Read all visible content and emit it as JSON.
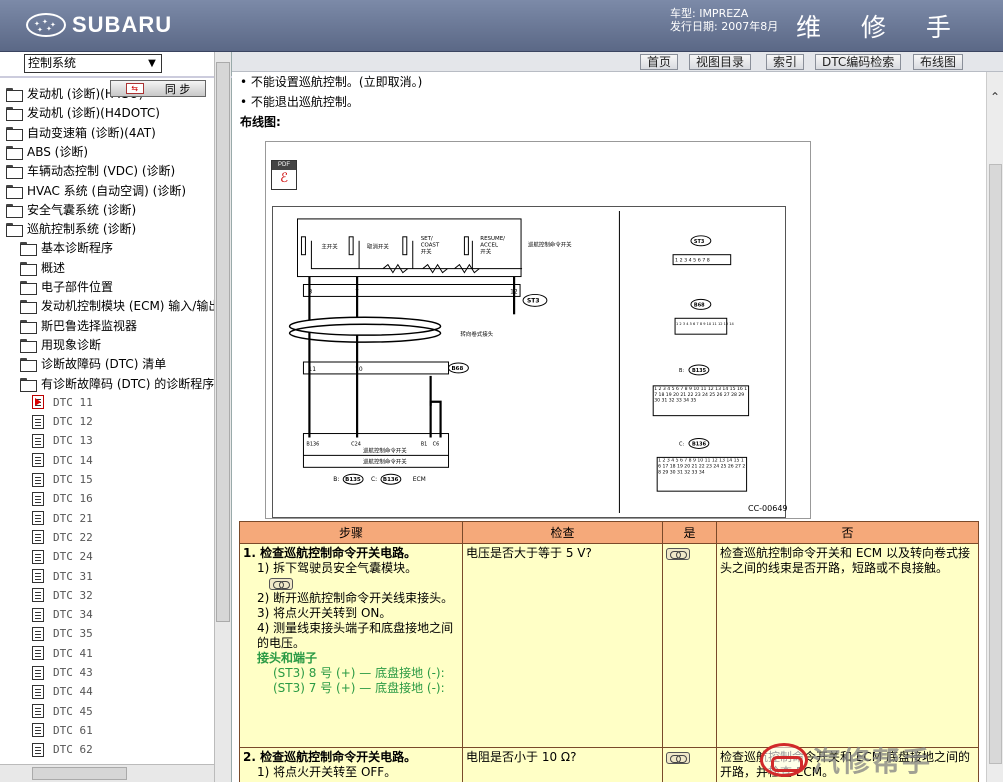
{
  "header": {
    "brand": "SUBARU",
    "model_line": "车型: IMPREZA",
    "issue_date_line": "发行日期: 2007年8月",
    "manual_title": "维 修 手 册"
  },
  "left_panel": {
    "system_select": "控制系统",
    "sync_label": "同 步",
    "sync_icon_text": "⇆",
    "tree": [
      {
        "label": "发动机 (诊断)(H4SO)",
        "type": "folder",
        "level": 0
      },
      {
        "label": "发动机 (诊断)(H4DOTC)",
        "type": "folder",
        "level": 0
      },
      {
        "label": "自动变速箱 (诊断)(4AT)",
        "type": "folder",
        "level": 0
      },
      {
        "label": "ABS (诊断)",
        "type": "folder",
        "level": 0
      },
      {
        "label": "车辆动态控制 (VDC) (诊断)",
        "type": "folder",
        "level": 0
      },
      {
        "label": "HVAC 系统 (自动空调) (诊断)",
        "type": "folder",
        "level": 0
      },
      {
        "label": "安全气囊系统 (诊断)",
        "type": "folder",
        "level": 0
      },
      {
        "label": "巡航控制系统 (诊断)",
        "type": "folder",
        "level": 0
      },
      {
        "label": "基本诊断程序",
        "type": "folder",
        "level": 1
      },
      {
        "label": "概述",
        "type": "folder",
        "level": 1
      },
      {
        "label": "电子部件位置",
        "type": "folder",
        "level": 1
      },
      {
        "label": "发动机控制模块 (ECM) 输入/输出",
        "type": "folder",
        "level": 1
      },
      {
        "label": "斯巴鲁选择监视器",
        "type": "folder",
        "level": 1
      },
      {
        "label": "用现象诊断",
        "type": "folder",
        "level": 1
      },
      {
        "label": "诊断故障码 (DTC) 清单",
        "type": "folder",
        "level": 1
      },
      {
        "label": "有诊断故障码 (DTC) 的诊断程序",
        "type": "folder",
        "level": 1
      },
      {
        "label": "DTC 11",
        "type": "doc",
        "level": 2,
        "active": true
      },
      {
        "label": "DTC 12",
        "type": "doc",
        "level": 2
      },
      {
        "label": "DTC 13",
        "type": "doc",
        "level": 2
      },
      {
        "label": "DTC 14",
        "type": "doc",
        "level": 2
      },
      {
        "label": "DTC 15",
        "type": "doc",
        "level": 2
      },
      {
        "label": "DTC 16",
        "type": "doc",
        "level": 2
      },
      {
        "label": "DTC 21",
        "type": "doc",
        "level": 2
      },
      {
        "label": "DTC 22",
        "type": "doc",
        "level": 2
      },
      {
        "label": "DTC 24",
        "type": "doc",
        "level": 2
      },
      {
        "label": "DTC 31",
        "type": "doc",
        "level": 2
      },
      {
        "label": "DTC 32",
        "type": "doc",
        "level": 2
      },
      {
        "label": "DTC 34",
        "type": "doc",
        "level": 2
      },
      {
        "label": "DTC 35",
        "type": "doc",
        "level": 2
      },
      {
        "label": "DTC 41",
        "type": "doc",
        "level": 2
      },
      {
        "label": "DTC 43",
        "type": "doc",
        "level": 2
      },
      {
        "label": "DTC 44",
        "type": "doc",
        "level": 2
      },
      {
        "label": "DTC 45",
        "type": "doc",
        "level": 2
      },
      {
        "label": "DTC 61",
        "type": "doc",
        "level": 2
      },
      {
        "label": "DTC 62",
        "type": "doc",
        "level": 2
      }
    ]
  },
  "toolbar": {
    "home": "首页",
    "view_index": "视图目录",
    "search_index": "索引",
    "dtc_search": "DTC编码检索",
    "wiring": "布线图"
  },
  "content": {
    "bullets": [
      "• 不能设置巡航控制。(立即取消。)",
      "• 不能退出巡航控制。"
    ],
    "wiring_label": "布线图:",
    "pdf_label": "PDF",
    "diagram": {
      "switch_labels": [
        "主开关",
        "取消开关",
        "SET/ COAST 开关",
        "RESUME/ ACCEL 开关"
      ],
      "set_line1": "SET/",
      "set_line2": "COAST",
      "resume_line1": "RESUME/",
      "resume_line2": "ACCEL",
      "main_switch": "主开关",
      "cancel_switch": "取消开关",
      "switch_suffix": "开关",
      "cruise_switch_box": "巡航控制命令开关",
      "roll_connector": "转向卷式接头",
      "st3": "ST3",
      "b68": "B68",
      "b135": "B135",
      "b136": "B136",
      "ecm": "ECM",
      "b_label": "B:",
      "c_label": "C:",
      "ecm_row1": "巡航控制命令开关",
      "ecm_row2": "巡航控制命令开关",
      "ecm_pins": [
        "B136",
        "C24",
        "B1",
        "C6"
      ],
      "pin_8": "8",
      "pin_7": "7",
      "pin_11": "11",
      "pin_12": "12",
      "pin_10": "10",
      "code": "CC-00649",
      "st3_pins": "1 2 3 4 5 6 7 8",
      "b68_pins": "1 2 3 4 5 6 7 8 9 10 11 12 13 14",
      "b135_pins": "1 2 3 4 5 6 7 8 9 10 11 12 13 14 15 16 17 18 19 20 21 22 23 24 25 26 27 28 29 30 31 32 33 34 35",
      "b136_pins": "1 2 3 4 5 6 7 8 9 10 11 12 13 14 15 16 17 18 19 20 21 22 23 24 25 26 27 28 29 30 31 32 33 34"
    },
    "table": {
      "headers": [
        "步骤",
        "检查",
        "是",
        "否"
      ],
      "rows": [
        {
          "title": "1. 检查巡航控制命令开关电路。",
          "lines": [
            "1) 拆下驾驶员安全气囊模块。"
          ],
          "lines2": [
            "2) 断开巡航控制命令开关线束接头。",
            "3) 将点火开关转到 ON。",
            "4) 测量线束接头端子和底盘接地之间的电压。"
          ],
          "green_title": "接头和端子",
          "green_lines": [
            "(ST3) 8 号 (+) — 底盘接地 (-):",
            "(ST3) 7 号 (+) — 底盘接地 (-):"
          ],
          "check": "电压是否大于等于 5 V?",
          "no": "检查巡航控制命令开关和 ECM 以及转向卷式接头之间的线束是否开路，短路或不良接触。"
        },
        {
          "title": "2. 检查巡航控制命令开关电路。",
          "lines": [
            "1) 将点火开关转至 OFF。"
          ],
          "check": "电阻是否小于 10 Ω?",
          "no": "检查巡航控制命令开关和 ECM 底盘接地之间的开路，并检查 ECM。"
        }
      ]
    }
  },
  "watermark": {
    "text": "汽修帮手"
  },
  "colors": {
    "header": "#6b7896",
    "table_header": "#f5a97a",
    "table_body": "#ffffc6",
    "green": "#2a9a44"
  }
}
